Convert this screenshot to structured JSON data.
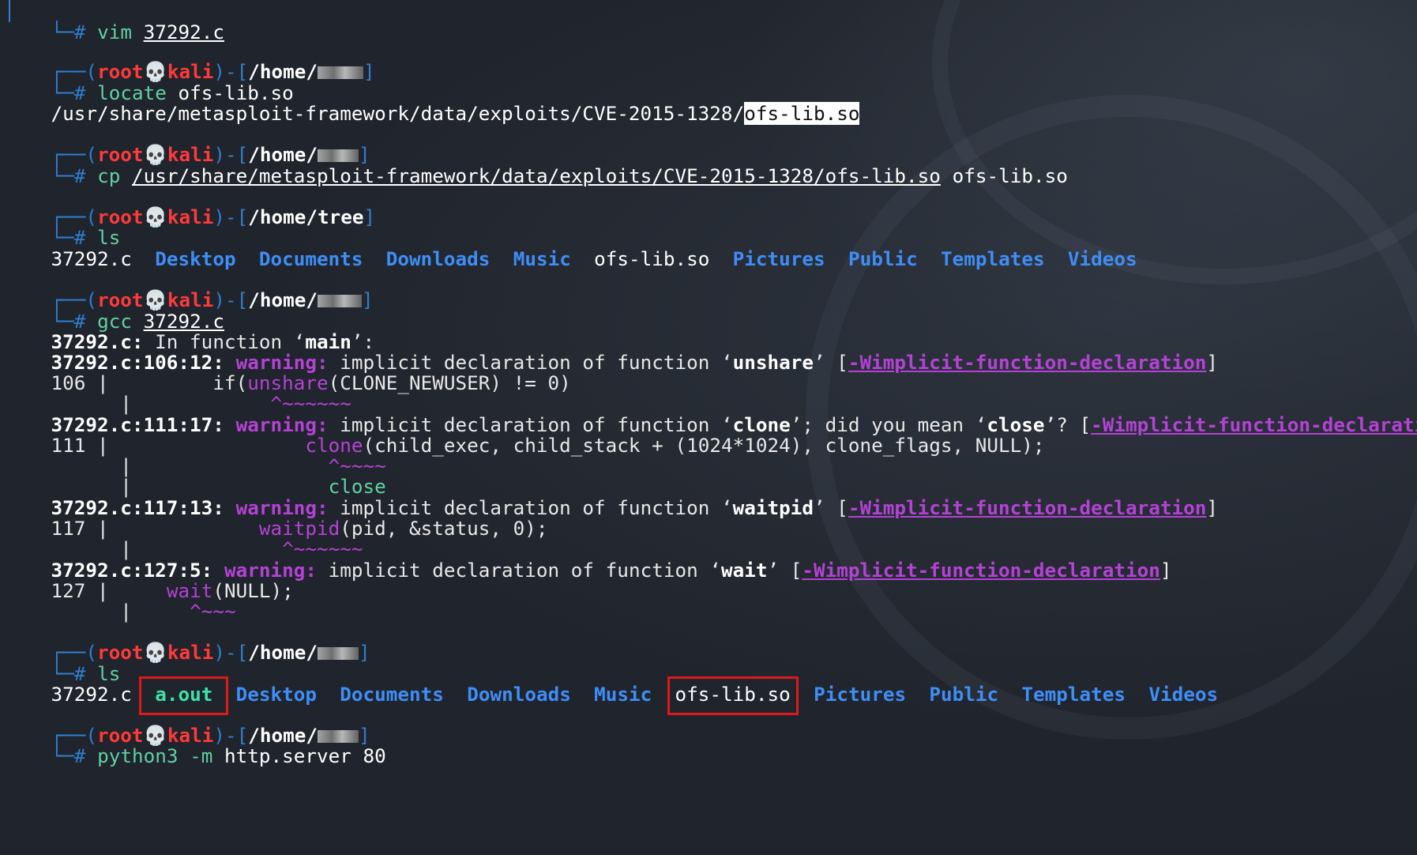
{
  "prompt": {
    "user": "root",
    "host": "kali",
    "skull": "💀",
    "home_prefix": "/home/",
    "hash": "#"
  },
  "lines": {
    "l0_cmd": "vim",
    "l0_arg": "37292.c",
    "p1_cmd": "locate",
    "p1_arg": "ofs-lib.so",
    "p1_out_prefix": "/usr/share/metasploit-framework/data/exploits/CVE-2015-1328/",
    "p1_out_hl": "ofs-lib.so",
    "p2_cmd": "cp",
    "p2_arg1": "/usr/share/metasploit-framework/data/exploits/CVE-2015-1328/ofs-lib.so",
    "p2_arg2": "ofs-lib.so",
    "p3_path": "/home/tree",
    "p3_cmd": "ls",
    "p4_cmd": "gcc",
    "p4_arg": "37292.c",
    "p5_cmd": "ls",
    "p6_cmd": "python3",
    "p6_flag": "-m",
    "p6_args": "http.server 80"
  },
  "ls1": {
    "f1": "37292.c",
    "d1": "Desktop",
    "d2": "Documents",
    "d3": "Downloads",
    "d4": "Music",
    "f2": "ofs-lib.so",
    "d5": "Pictures",
    "d6": "Public",
    "d7": "Templates",
    "d8": "Videos"
  },
  "ls2": {
    "f1": "37292.c",
    "exe": "a.out",
    "d1": "Desktop",
    "d2": "Documents",
    "d3": "Downloads",
    "d4": "Music",
    "f2": "ofs-lib.so",
    "d5": "Pictures",
    "d6": "Public",
    "d7": "Templates",
    "d8": "Videos"
  },
  "gcc": {
    "infunc_file": "37292.c:",
    "infunc_text": " In function ‘",
    "infunc_name": "main",
    "infunc_end": "’:",
    "warning_label": "warning:",
    "implicit": " implicit declaration of function ‘",
    "flag": "-Wimplicit-function-declaration",
    "w1_loc": "37292.c:106:12:",
    "w1_fn": "unshare",
    "w1_lineno": "106",
    "w1_code_pre": "if(",
    "w1_code_fn": "unshare",
    "w1_code_post": "(CLONE_NEWUSER) != 0)",
    "w1_caret": "^~~~~~~",
    "w2_loc": "37292.c:111:17:",
    "w2_fn": "clone",
    "w2_mid": "’; did you mean ‘",
    "w2_suggest": "close",
    "w2_end": "’? [",
    "w2_lineno": "111",
    "w2_code_fn": "clone",
    "w2_code_post": "(child_exec, child_stack + (1024*1024), clone_flags, NULL);",
    "w2_caret": "^~~~~",
    "w2_fix": "close",
    "w3_loc": "37292.c:117:13:",
    "w3_fn": "waitpid",
    "w3_lineno": "117",
    "w3_code_fn": "waitpid",
    "w3_code_post": "(pid, &status, 0);",
    "w3_caret": "^~~~~~~",
    "w4_loc": "37292.c:127:5:",
    "w4_fn": "wait",
    "w4_lineno": "127",
    "w4_code_fn": "wait",
    "w4_code_post": "(NULL);",
    "w4_caret": "^~~~"
  }
}
